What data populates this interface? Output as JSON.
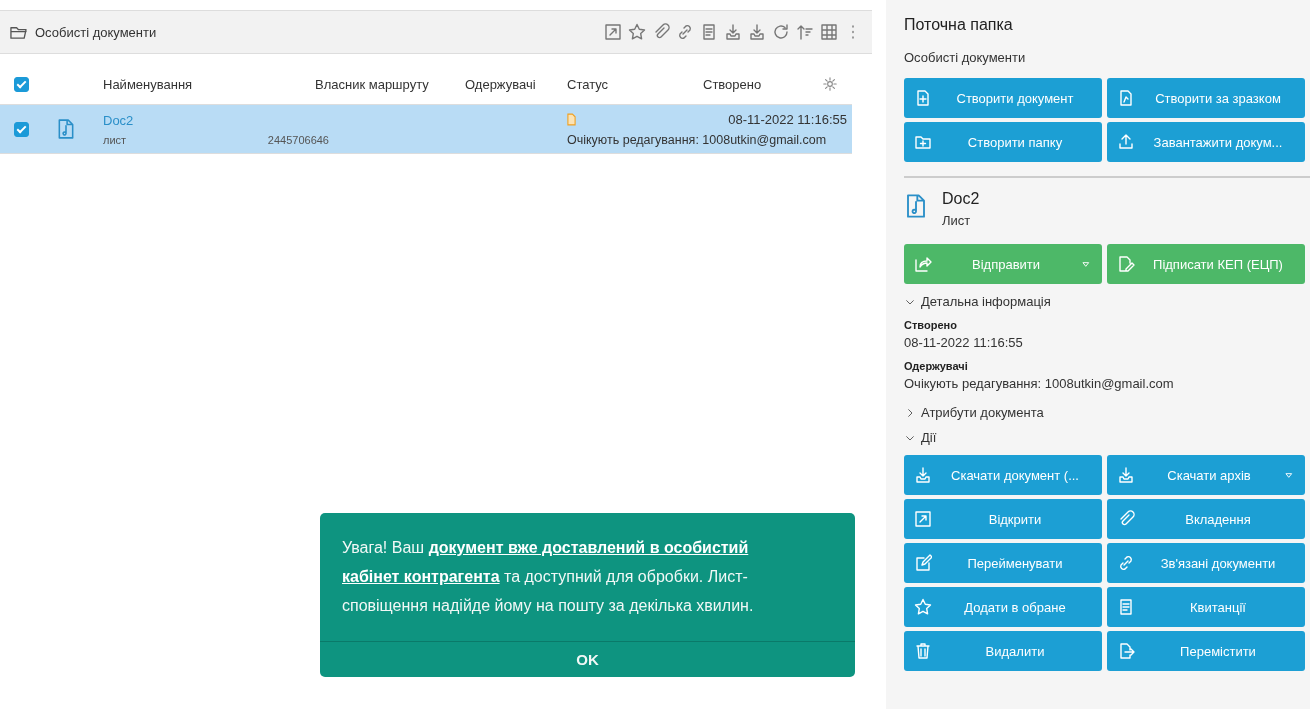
{
  "folder_bar": {
    "title": "Особисті документи"
  },
  "table": {
    "select_all": {
      "checked": true
    },
    "columns": [
      {
        "label": "Найменування"
      },
      {
        "label": "Власник маршруту"
      },
      {
        "label": "Одержувачі"
      },
      {
        "label": "Статус"
      },
      {
        "label": "Створено"
      }
    ],
    "rows": [
      {
        "checked": true,
        "selected": true,
        "name": "Doc2",
        "type": "лист",
        "number": "2445706646",
        "created": "08-11-2022 11:16:55",
        "status_note": "Очікують редагування: 1008utkin@gmail.com"
      }
    ]
  },
  "toast": {
    "message": [
      {
        "text": "Увага! Ваш",
        "link": false
      },
      {
        "text": "документ вже доставлений в особистий",
        "link": true
      },
      {
        "text": "кабінет контрагента",
        "link": true
      },
      {
        "text": "та доступний для обробки. Лист-сповіщення надійде йому на пошту за декілька хвилин.",
        "link": false
      }
    ],
    "button": "OK"
  },
  "side": {
    "title": "Поточна папка",
    "folder": "Особисті документи",
    "folder_buttons": [
      {
        "label": "Створити документ",
        "dropdown": false
      },
      {
        "label": "Створити за зразком",
        "dropdown": false
      },
      {
        "label": "Створити папку",
        "dropdown": false
      },
      {
        "label": "Завантажити докум...",
        "dropdown": false
      }
    ],
    "document": {
      "name": "Doc2",
      "type": "Лист"
    },
    "doc_buttons": [
      {
        "label": "Відправити",
        "dropdown": true
      },
      {
        "label": "Підписати КЕП (ЕЦП)",
        "dropdown": false
      }
    ],
    "sections": [
      {
        "kind": "fields",
        "title": "Детальна інформація",
        "expanded": true,
        "fields": [
          {
            "label": "Створено",
            "value": "08-11-2022 11:16:55"
          },
          {
            "label": "Одержувачі",
            "value": "Очікують редагування: 1008utkin@gmail.com"
          }
        ]
      },
      {
        "title": "Атрибути документа",
        "expanded": false
      },
      {
        "kind": "buttons",
        "title": "Дії",
        "expanded": true,
        "buttons": [
          {
            "label": "Скачати документ (...",
            "dropdown": false
          },
          {
            "label": "Скачати архів",
            "dropdown": true
          },
          {
            "label": "Відкрити",
            "dropdown": false
          },
          {
            "label": "Вкладення",
            "dropdown": false
          },
          {
            "label": "Перейменувати",
            "dropdown": false
          },
          {
            "label": "Зв'язані документи",
            "dropdown": false
          },
          {
            "label": "Додати в обране",
            "dropdown": false
          },
          {
            "label": "Квитанції",
            "dropdown": false
          },
          {
            "label": "Видалити",
            "dropdown": false
          },
          {
            "label": "Перемістити",
            "dropdown": false
          }
        ]
      }
    ]
  }
}
